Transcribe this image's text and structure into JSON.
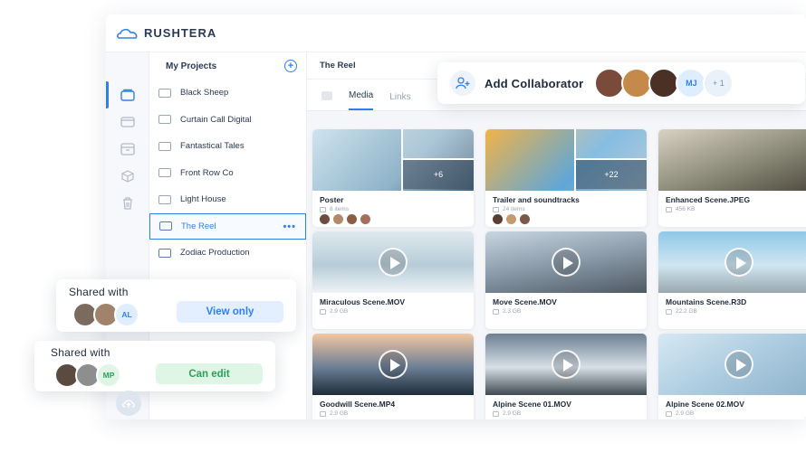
{
  "app": {
    "brand": "RUSHTERA"
  },
  "projects": {
    "header": "My Projects",
    "items": [
      {
        "label": "Black Sheep",
        "selected": false,
        "shared": false
      },
      {
        "label": "Curtain Call Digital",
        "selected": false,
        "shared": false
      },
      {
        "label": "Fantastical Tales",
        "selected": false,
        "shared": false
      },
      {
        "label": "Front Row Co",
        "selected": false,
        "shared": false
      },
      {
        "label": "Light House",
        "selected": false,
        "shared": false
      },
      {
        "label": "The Reel",
        "selected": true,
        "shared": true
      },
      {
        "label": "Zodiac Production",
        "selected": false,
        "shared": true
      }
    ],
    "more_icon": "•••"
  },
  "main": {
    "title": "The Reel",
    "tabs": [
      {
        "label": "Media",
        "active": true
      },
      {
        "label": "Links",
        "active": false
      }
    ]
  },
  "collaborators": {
    "label": "Add Collaborator",
    "initials": "MJ",
    "more": "+ 1"
  },
  "media": [
    {
      "name": "Poster",
      "meta": "8 items",
      "type": "folder",
      "more": "+6"
    },
    {
      "name": "Trailer and soundtracks",
      "meta": "24 items",
      "type": "folder",
      "more": "+22"
    },
    {
      "name": "Enhanced Scene.JPEG",
      "meta": "456 KB",
      "type": "image"
    },
    {
      "name": "Miraculous Scene.MOV",
      "meta": "2.9 GB",
      "type": "video"
    },
    {
      "name": "Move Scene.MOV",
      "meta": "2.3 GB",
      "type": "video"
    },
    {
      "name": "Mountains Scene.R3D",
      "meta": "22.2 GB",
      "type": "video"
    },
    {
      "name": "Goodwill Scene.MP4",
      "meta": "2.9 GB",
      "type": "video"
    },
    {
      "name": "Alpine Scene 01.MOV",
      "meta": "2.9 GB",
      "type": "video"
    },
    {
      "name": "Alpine Scene 02.MOV",
      "meta": "2.9 GB",
      "type": "video"
    }
  ],
  "share_view": {
    "title": "Shared with",
    "initials": "AL",
    "permission": "View only"
  },
  "share_edit": {
    "title": "Shared with",
    "initials": "MP",
    "permission": "Can edit"
  },
  "colors": {
    "accent": "#2f80ed",
    "view_bg": "#e3efff",
    "edit_bg": "#dff6e6",
    "edit_text": "#2e9f58"
  }
}
